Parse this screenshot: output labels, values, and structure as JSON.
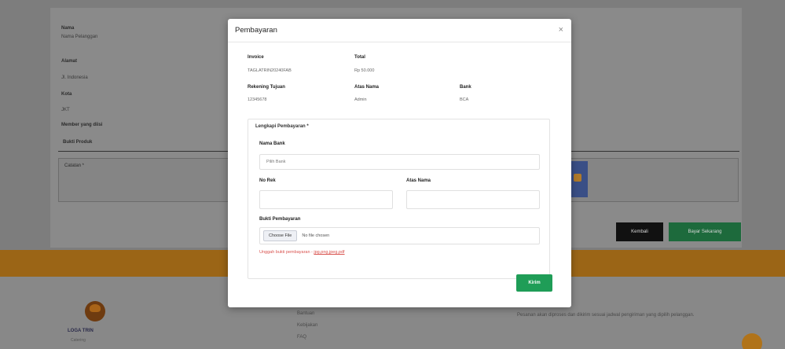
{
  "background": {
    "fields": [
      {
        "label": "Nama",
        "value": "Nama Pelanggan"
      },
      {
        "label": "Alamat",
        "value": "Jl. Indonesia"
      },
      {
        "label": "Kota",
        "value": "JKT"
      }
    ],
    "member_label": "Member yang diisi",
    "section_tab": "Bukti Produk",
    "textarea_label": "Catatan *",
    "btn_back": "Kembali",
    "btn_next": "Bayar Sekarang",
    "footer": {
      "brand": "LOGA TRIN",
      "brand_sub": "Catering",
      "links": [
        "Bantuan",
        "Kebijakan",
        "FAQ"
      ],
      "text": "Pesanan akan diproses dan dikirim sesuai jadwal pengiriman yang dipilih pelanggan."
    }
  },
  "modal": {
    "title": "Pembayaran",
    "close_icon": "×",
    "invoice_label": "Invoice",
    "invoice_value": "TAGLATRIN20240FAB",
    "total_label": "Total",
    "total_value": "Rp 50.000",
    "rekening_label": "Rekening Tujuan",
    "rekening_value": "12345678",
    "atas_nama_label": "Atas Nama",
    "atas_nama_value": "Admin",
    "bank_label": "Bank",
    "bank_value": "BCA",
    "section_title": "Lengkapi Pembayaran *",
    "nama_bank_label": "Nama Bank",
    "nama_bank_placeholder": "Pilih Bank",
    "no_rek_label": "No Rek",
    "no_rek_value": "",
    "atas_nama_field_label": "Atas Nama",
    "atas_nama_field_value": "",
    "bukti_label": "Bukti Pembayaran",
    "file_button": "Choose File",
    "file_status": "No file chosen",
    "help_text": "Unggah bukti pembayaran -",
    "help_link": "jpg,png,jpeg,pdf",
    "submit_label": "Kirim"
  },
  "colors": {
    "submit": "#1f9d57",
    "help": "#d9534f",
    "orange_band": "#9b6516"
  }
}
